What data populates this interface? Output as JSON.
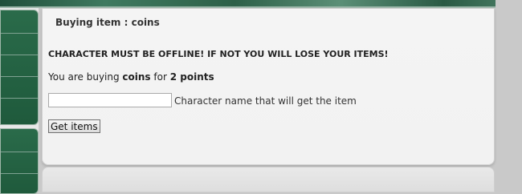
{
  "panel": {
    "title": "Buying item : coins"
  },
  "content": {
    "warning": "CHARACTER MUST BE OFFLINE! IF NOT YOU WILL LOSE YOUR ITEMS!",
    "buy_prefix": "You are buying ",
    "item_name": "coins",
    "buy_middle": " for ",
    "price": "2 points"
  },
  "form": {
    "character_input_value": "",
    "character_label": "Character name that will get the item",
    "submit_label": "Get items"
  },
  "colors": {
    "sidebar_green": "#2a6b4a",
    "background": "#c9c9c9",
    "panel": "#f2f2f2"
  }
}
